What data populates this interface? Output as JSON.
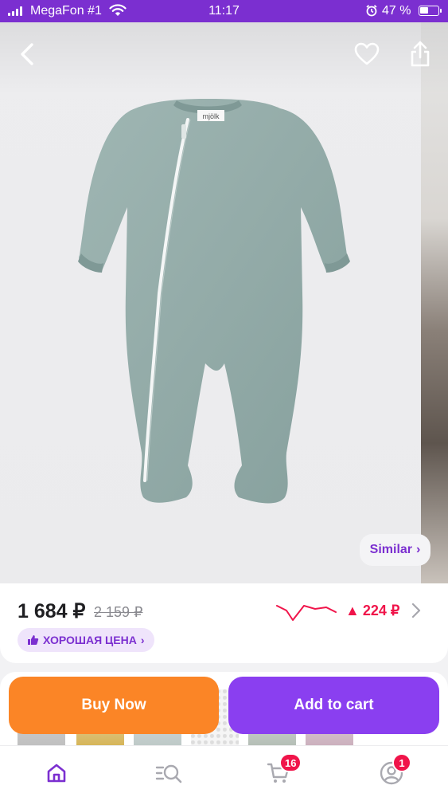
{
  "status_bar": {
    "carrier": "MegaFon #1",
    "time": "11:17",
    "battery_percent": "47 %",
    "battery_level": 0.47,
    "signal_bars": 4
  },
  "gallery": {
    "brand_tag": "mjölk",
    "similar_label": "Similar",
    "similar_chevron": "›"
  },
  "product": {
    "price": "1 684 ₽",
    "old_price": "2 159 ₽",
    "price_change": "224 ₽",
    "price_change_arrow": "▲",
    "badge_label": "ХОРОШАЯ ЦЕНА",
    "badge_chevron": "›"
  },
  "actions": {
    "buy_now": "Buy Now",
    "add_to_cart": "Add to cart"
  },
  "bottom_nav": {
    "cart_count": "16",
    "profile_count": "1"
  },
  "icons": {
    "back": "chevron-left-icon",
    "favorite": "heart-icon",
    "share": "share-icon",
    "thumb": "thumbs-up-icon",
    "home": "home-icon",
    "catalog": "catalog-search-icon",
    "cart": "cart-icon",
    "profile": "profile-icon"
  },
  "colors": {
    "brand_purple": "#7b2fd0",
    "buy_orange": "#fb8526",
    "cart_purple": "#8a3ff0",
    "price_up_red": "#f0144a",
    "product_green": "#94acaa"
  }
}
